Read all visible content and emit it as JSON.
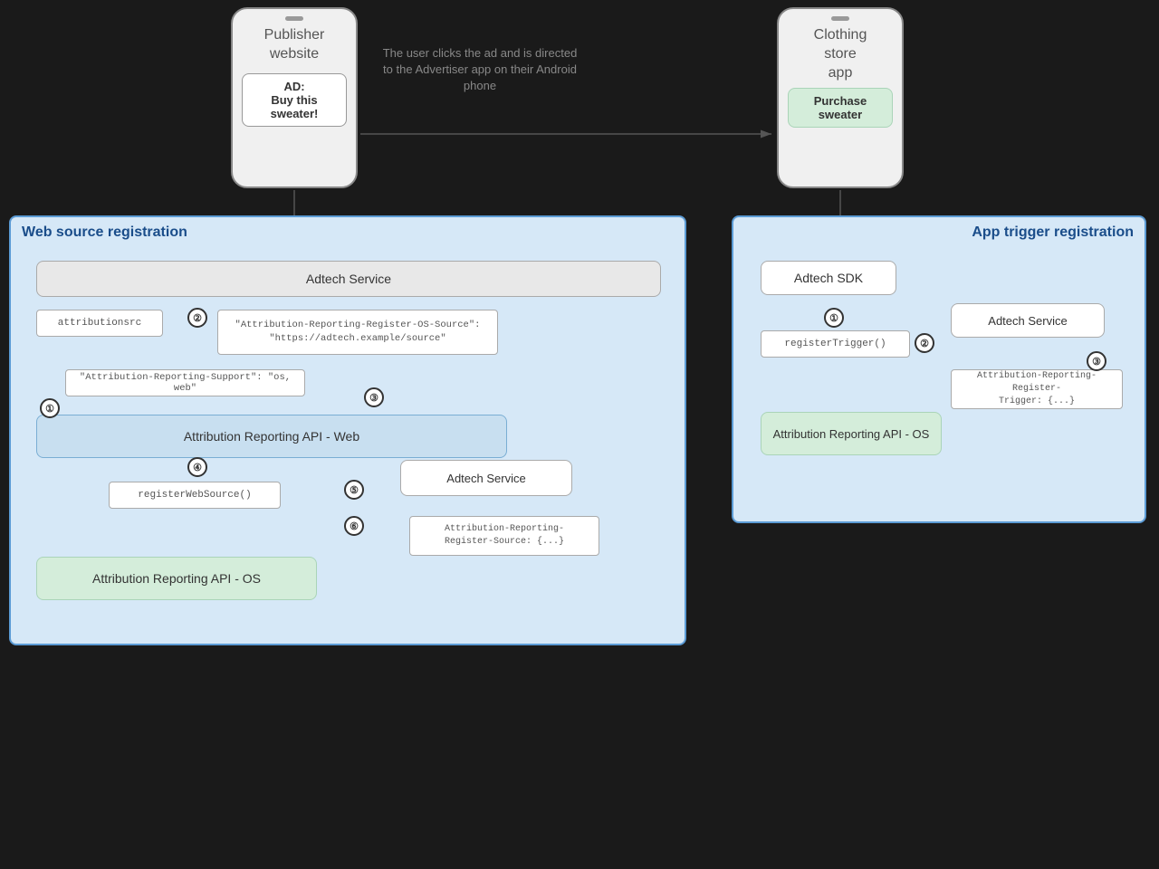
{
  "publisher_phone": {
    "title": "Publisher\nwebsite",
    "ad_label": "AD:",
    "ad_text": "Buy this\nsweater!"
  },
  "clothing_phone": {
    "title": "Clothing\nstore\napp",
    "button_text": "Purchase\nsweater"
  },
  "user_clicks_text": "The user clicks the ad and is\ndirected to the Advertiser app on\ntheir Android phone",
  "web_source_box": {
    "title": "Web source registration",
    "adtech_service_top": "Adtech Service",
    "attributionsrc": "attributionsrc",
    "header_response": "\"Attribution-Reporting-Register-OS-Source\":\n\"https://adtech.example/source\"",
    "support_header": "\"Attribution-Reporting-Support\": \"os, web\"",
    "api_web": "Attribution Reporting API - Web",
    "register_web_source": "registerWebSource()",
    "adtech_service_bottom": "Adtech Service",
    "register_source_header": "Attribution-Reporting-\nRegister-Source: {...}",
    "api_os": "Attribution Reporting API - OS"
  },
  "app_trigger_box": {
    "title": "App trigger registration",
    "adtech_sdk": "Adtech SDK",
    "register_trigger": "registerTrigger()",
    "adtech_service": "Adtech Service",
    "register_trigger_header": "Attribution-Reporting-Register-\nTrigger: {...}",
    "api_os": "Attribution Reporting API - OS"
  },
  "step_numbers": {
    "web": [
      "①",
      "②",
      "③",
      "④",
      "⑤",
      "⑥"
    ],
    "app": [
      "①",
      "②",
      "③"
    ]
  }
}
